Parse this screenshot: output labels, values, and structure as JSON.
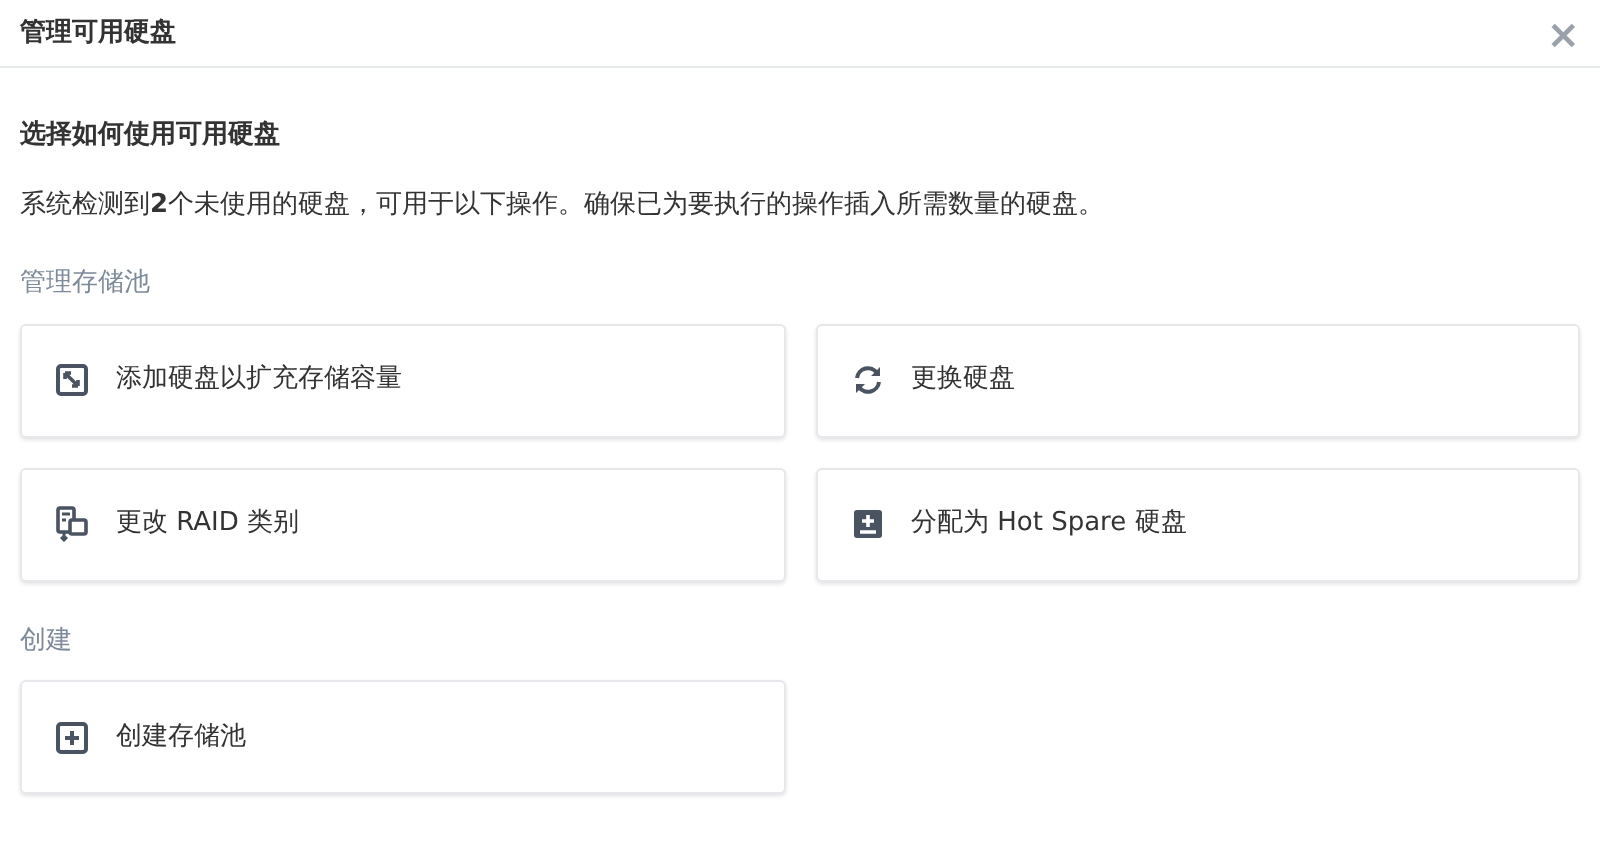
{
  "window": {
    "title": "管理可用硬盘",
    "close": "×"
  },
  "heading": "选择如何使用可用硬盘",
  "description": "系统检测到**2**个未使用的硬盘，可用于以下操作。确保已为要执行的操作插入所需数量的硬盘。",
  "sections": [
    {
      "label": "管理存储池",
      "options": [
        {
          "kind": "expand",
          "label": "添加硬盘以扩充存储容量"
        },
        {
          "kind": "replace",
          "label": "更换硬盘"
        },
        {
          "kind": "raid",
          "label": "更改 RAID 类别"
        },
        {
          "kind": "spare",
          "label": "分配为 Hot Spare 硬盘"
        }
      ]
    },
    {
      "label": "创建",
      "options": [
        {
          "kind": "create",
          "label": "创建存储池"
        }
      ]
    }
  ]
}
